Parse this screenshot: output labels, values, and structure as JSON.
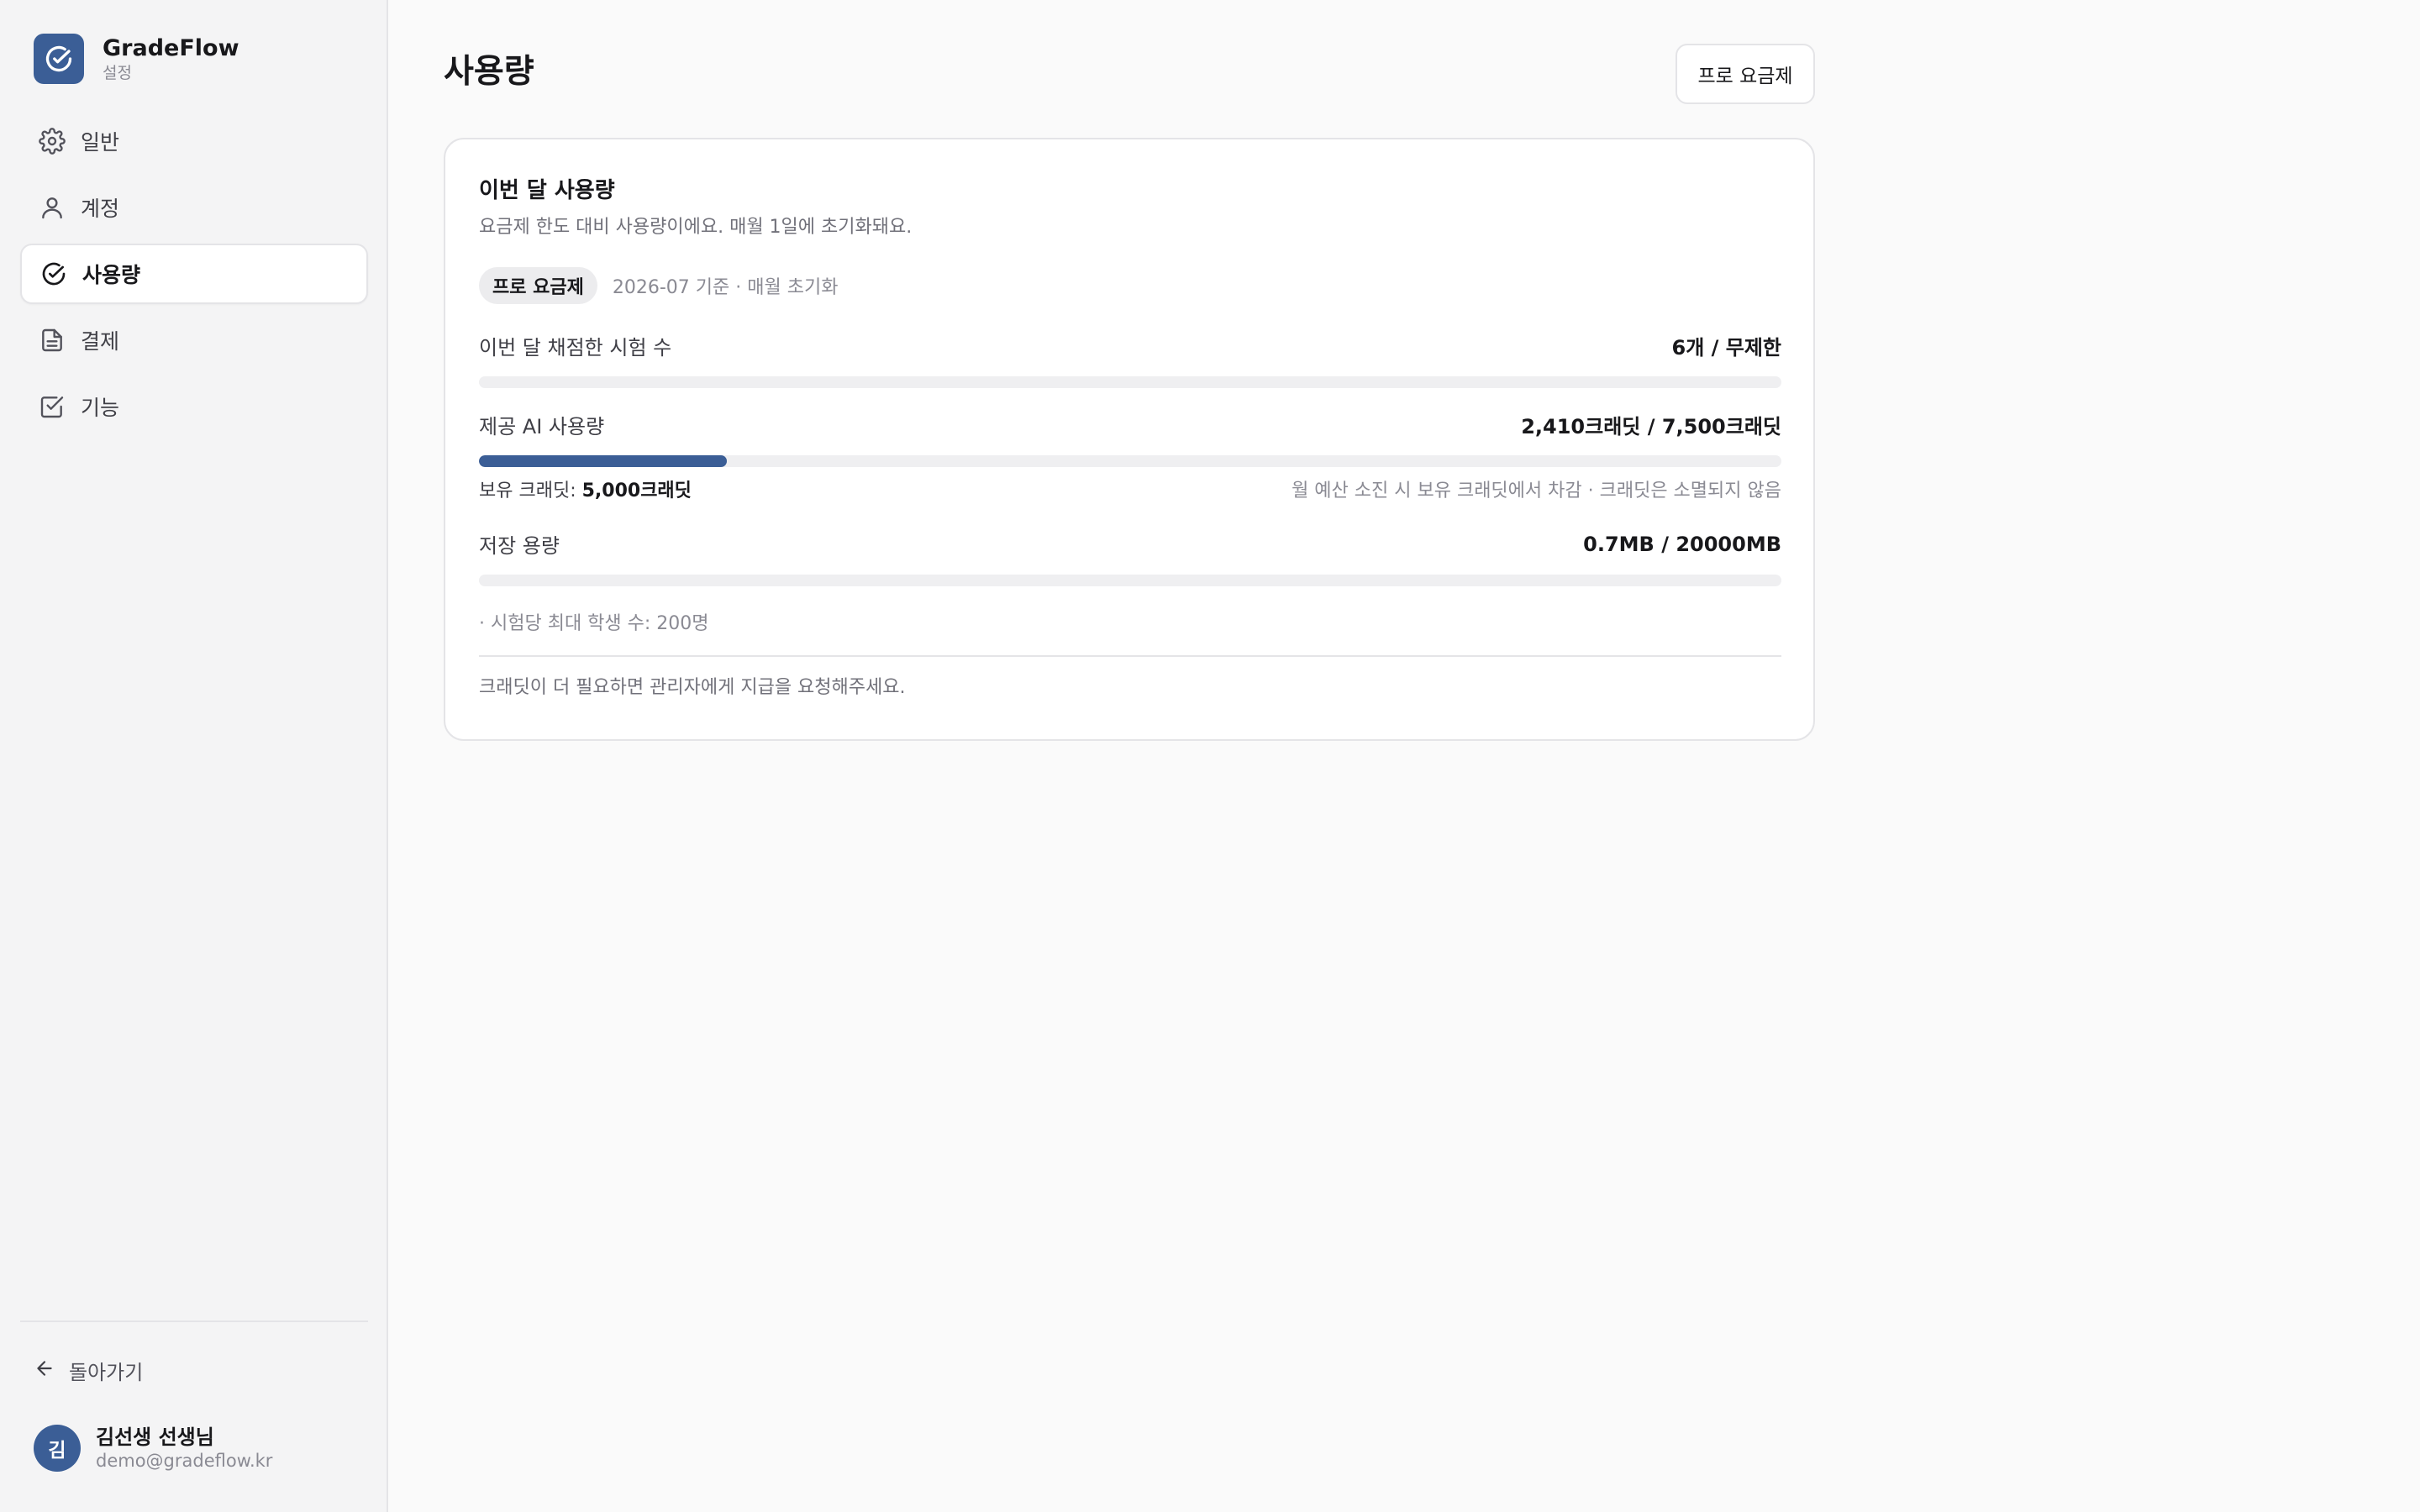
{
  "brand": {
    "name": "GradeFlow",
    "subtitle": "설정"
  },
  "nav": {
    "items": [
      {
        "label": "일반",
        "icon": "gear-icon"
      },
      {
        "label": "계정",
        "icon": "user-icon"
      },
      {
        "label": "사용량",
        "icon": "check-circle-icon",
        "active": true
      },
      {
        "label": "결제",
        "icon": "document-icon"
      },
      {
        "label": "기능",
        "icon": "checkbox-icon"
      }
    ]
  },
  "footer": {
    "back_label": "돌아가기",
    "user": {
      "initial": "김",
      "name": "김선생 선생님",
      "email": "demo@gradeflow.kr"
    }
  },
  "header": {
    "title": "사용량",
    "plan_button": "프로 요금제"
  },
  "usage_card": {
    "title": "이번 달 사용량",
    "description": "요금제 한도 대비 사용량이에요. 매월 1일에 초기화돼요.",
    "plan_badge": "프로 요금제",
    "plan_meta": "2026-07 기준 · 매월 초기화",
    "metrics": [
      {
        "label": "이번 달 채점한 시험 수",
        "value": "6개 / 무제한",
        "fill": 0
      },
      {
        "label": "제공 AI 사용량",
        "value": "2,410크래딧 / 7,500크래딧",
        "fill": 0.19
      },
      {
        "label": "저장 용량",
        "value": "0.7MB / 20000MB",
        "fill": 0
      }
    ],
    "credits": {
      "prefix": "보유 크래딧:",
      "amount": "5,000크래딧",
      "note": "월 예산 소진 시 보유 크래딧에서 차감 · 크래딧은 소멸되지 않음"
    },
    "limit_note": "· 시험당 최대 학생 수: 200명",
    "footer_note": "크래딧이 더 필요하면 관리자에게 지급을 요청해주세요."
  },
  "colors": {
    "accent": "#3b5e96",
    "track": "#efeff1",
    "border": "#e4e4e7"
  }
}
